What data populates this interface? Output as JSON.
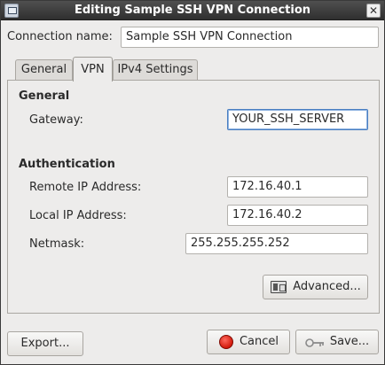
{
  "window": {
    "title": "Editing Sample SSH VPN Connection",
    "close_glyph": "✕"
  },
  "connection": {
    "name_label": "Connection name:",
    "name_value": "Sample SSH VPN Connection"
  },
  "tabs": [
    {
      "label": "General",
      "active": false
    },
    {
      "label": "VPN",
      "active": true
    },
    {
      "label": "IPv4 Settings",
      "active": false
    }
  ],
  "vpn": {
    "general_heading": "General",
    "gateway_label": "Gateway:",
    "gateway_value": "YOUR_SSH_SERVER",
    "auth_heading": "Authentication",
    "remote_ip_label": "Remote IP Address:",
    "remote_ip_value": "172.16.40.1",
    "local_ip_label": "Local IP Address:",
    "local_ip_value": "172.16.40.2",
    "netmask_label": "Netmask:",
    "netmask_value": "255.255.255.252",
    "advanced_label": "Advanced..."
  },
  "footer": {
    "export_label": "Export...",
    "cancel_label": "Cancel",
    "save_label": "Save..."
  },
  "icons": {
    "window": "network-vpn-icon",
    "close": "close-icon",
    "advanced": "settings-icon",
    "cancel": "cancel-icon",
    "save": "key-icon"
  },
  "colors": {
    "titlebar": "#3d3d3d",
    "window_bg": "#edeceb",
    "focus_border": "#4a7fc1",
    "cancel_red": "#d21a0c"
  }
}
